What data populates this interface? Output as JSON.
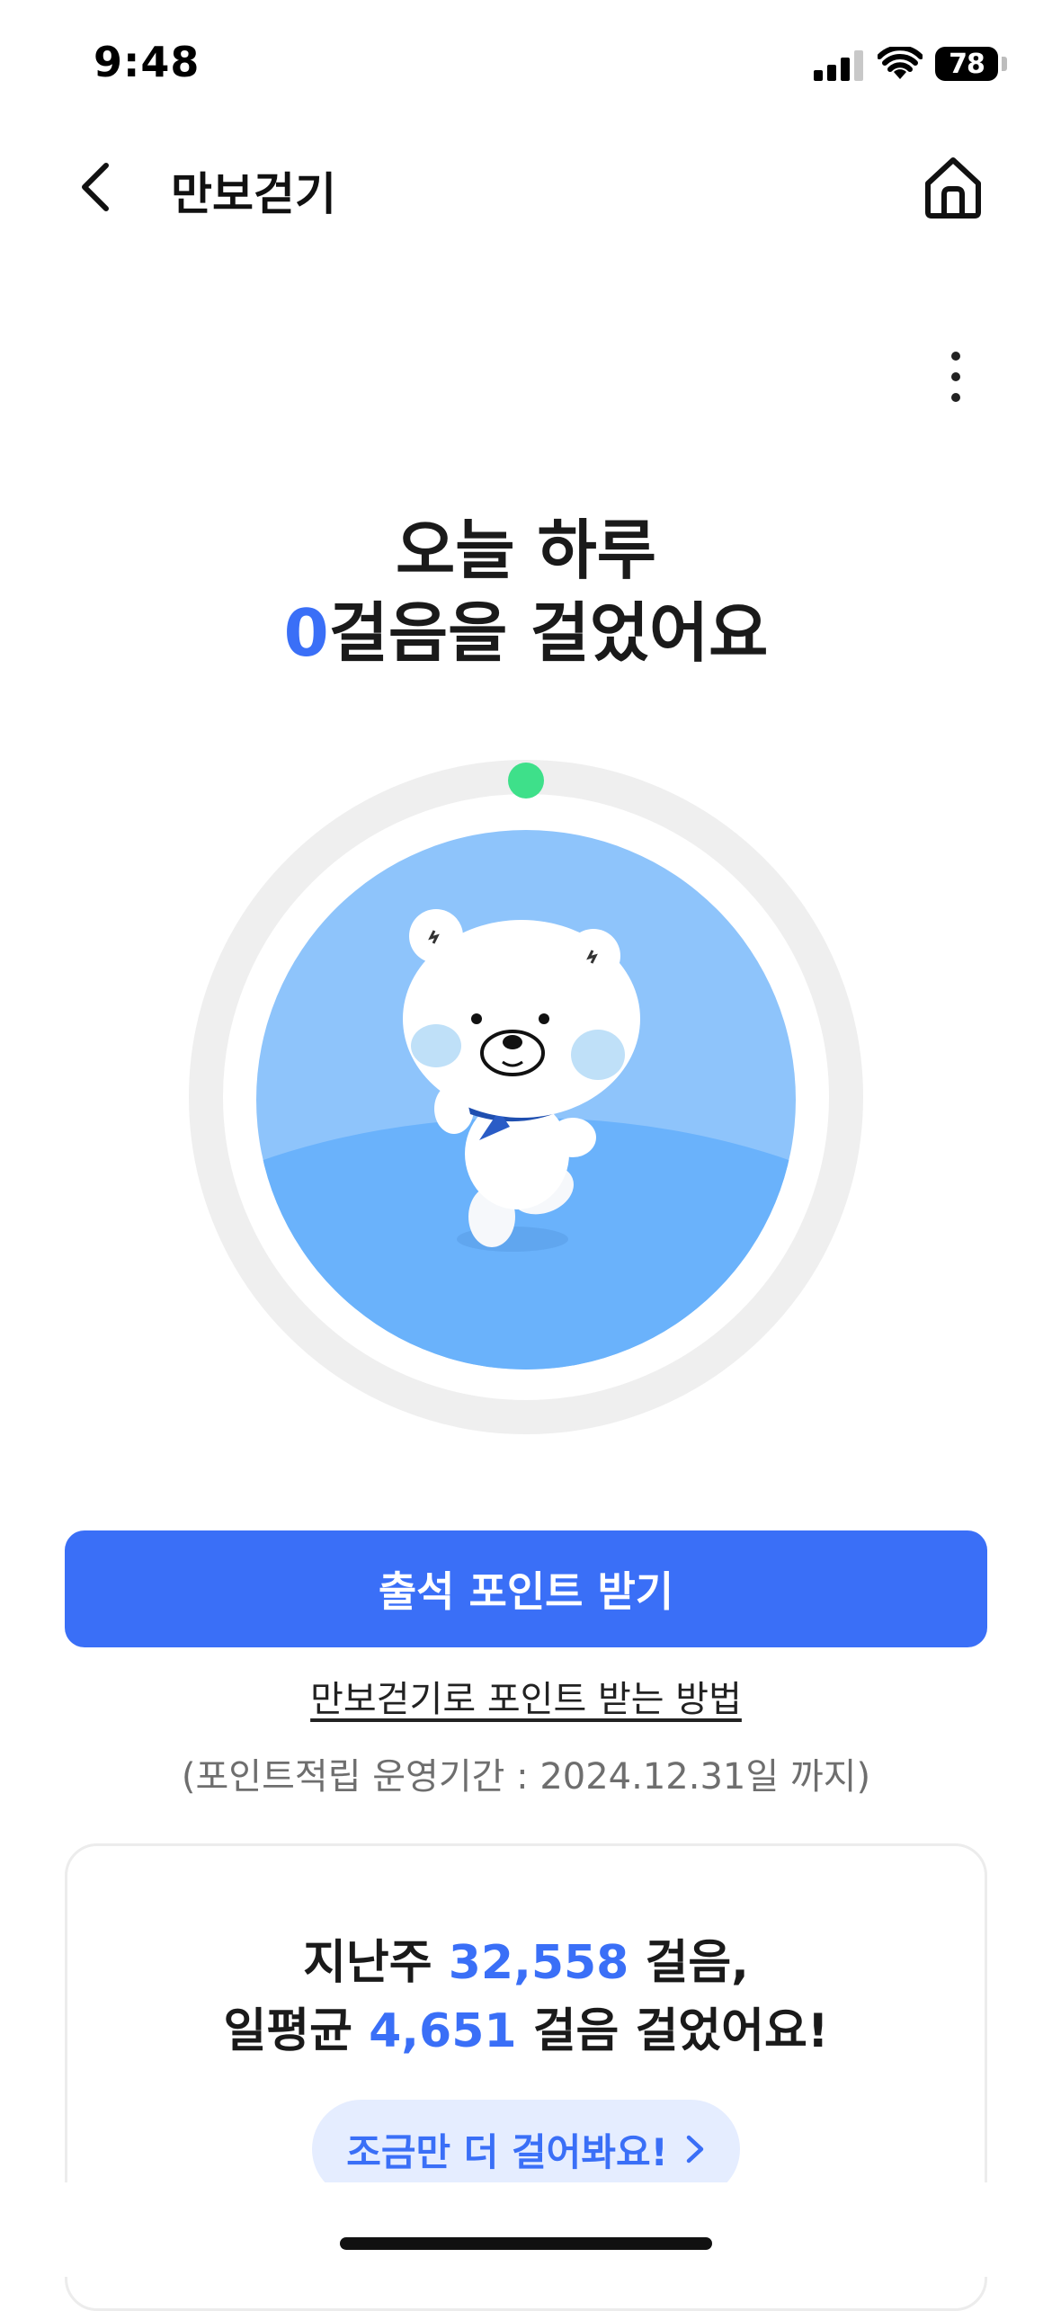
{
  "status_bar": {
    "time": "9:48",
    "battery": "78",
    "icons": [
      "signal-icon",
      "wifi-icon",
      "battery-icon"
    ]
  },
  "header": {
    "title": "만보걷기",
    "icons": [
      "back-arrow-icon",
      "home-icon",
      "more-vertical-icon"
    ]
  },
  "hero": {
    "line1": "오늘 하루",
    "steps": "0",
    "line2_suffix": "걸음을 걸었어요",
    "mascot": "bear-mascot",
    "progress_fraction": 0
  },
  "actions": {
    "attend_label": "출석 포인트 받기",
    "howto_link": "만보걷기로 포인트 받는 방법",
    "period_text": "(포인트적립 운영기간 : 2024.12.31일 까지)"
  },
  "summary": {
    "last_week_prefix": "지난주",
    "last_week_steps": "32,558",
    "last_week_suffix": "걸음,",
    "avg_prefix": "일평균",
    "avg_steps": "4,651",
    "avg_suffix": "걸음 걸었어요!",
    "button_label": "조금만 더 걸어봐요!"
  },
  "colors": {
    "accent": "#3a6ff7",
    "ring_track": "#efefef",
    "ring_dot": "#3ee08a",
    "circle_sky": "#8ec4fb",
    "circle_ground": "#6ab2fb",
    "pill_bg": "#e5edff"
  }
}
